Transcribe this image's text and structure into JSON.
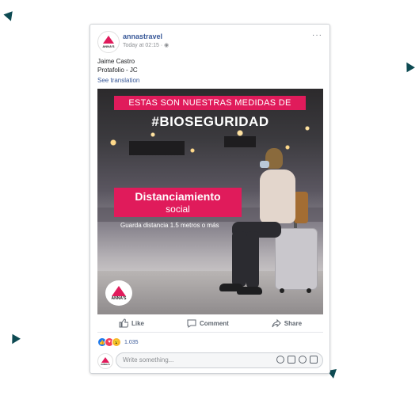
{
  "page": {
    "bg": "#ffffff",
    "decor_color": "#0d4a52"
  },
  "post": {
    "page_name": "annastravel",
    "timestamp": "Today at 02:15 ·",
    "text_lines": [
      "Jaime Castro",
      "Protafolio - JC"
    ],
    "see_translation": "See translation",
    "more_label": "···"
  },
  "image": {
    "banner_top": "ESTAS SON NUESTRAS MEDIDAS DE",
    "hashtag": "#BIOSEGURIDAD",
    "title_line1": "Distanciamiento",
    "title_line2": "social",
    "subtitle": "Guarda distancia 1.5 metros o más",
    "badge_text": "ANNA'S",
    "accent": "#e01b5b"
  },
  "actions": [
    {
      "icon": "like-icon",
      "label": "Like"
    },
    {
      "icon": "comment-icon",
      "label": "Comment"
    },
    {
      "icon": "share-icon",
      "label": "Share"
    }
  ],
  "reactions": {
    "count": "1.035",
    "types": [
      "like",
      "love",
      "wow"
    ]
  },
  "comment_box": {
    "placeholder": "Write something...",
    "icons": [
      "emoji-icon",
      "camera-icon",
      "gif-icon",
      "sticker-icon"
    ]
  },
  "brand_logo_text": "ANNA'S"
}
